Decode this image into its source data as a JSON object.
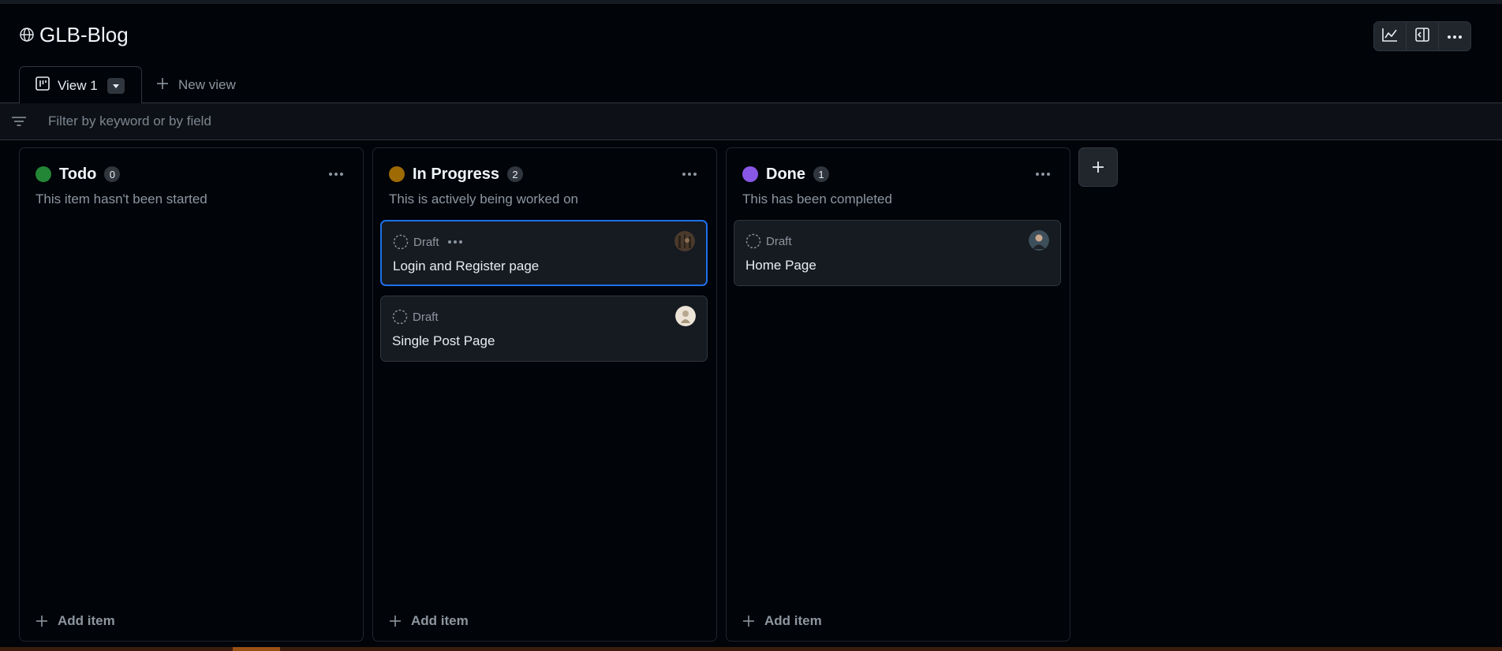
{
  "project": {
    "title": "GLB-Blog"
  },
  "toolbar": {
    "insights_icon": "graph-icon",
    "panel_icon": "sidebar-expand-icon",
    "more_icon": "kebab-horizontal-icon"
  },
  "tabs": {
    "active": {
      "label": "View 1",
      "icon": "project-board-icon"
    },
    "new_view_label": "New view"
  },
  "filter": {
    "placeholder": "Filter by keyword or by field",
    "value": ""
  },
  "columns": [
    {
      "name": "Todo",
      "count": "0",
      "color": "#238636",
      "description": "This item hasn't been started",
      "add_label": "Add item",
      "cards": []
    },
    {
      "name": "In Progress",
      "count": "2",
      "color": "#9e6a03",
      "description": "This is actively being worked on",
      "add_label": "Add item",
      "cards": [
        {
          "status": "Draft",
          "title": "Login and Register page",
          "selected": true
        },
        {
          "status": "Draft",
          "title": "Single Post Page",
          "selected": false
        }
      ]
    },
    {
      "name": "Done",
      "count": "1",
      "color": "#8957e5",
      "description": "This has been completed",
      "add_label": "Add item",
      "cards": [
        {
          "status": "Draft",
          "title": "Home Page",
          "selected": false
        }
      ]
    }
  ],
  "colors": {
    "background": "#010409",
    "accent": "#1f6feb",
    "border": "#30363d"
  }
}
